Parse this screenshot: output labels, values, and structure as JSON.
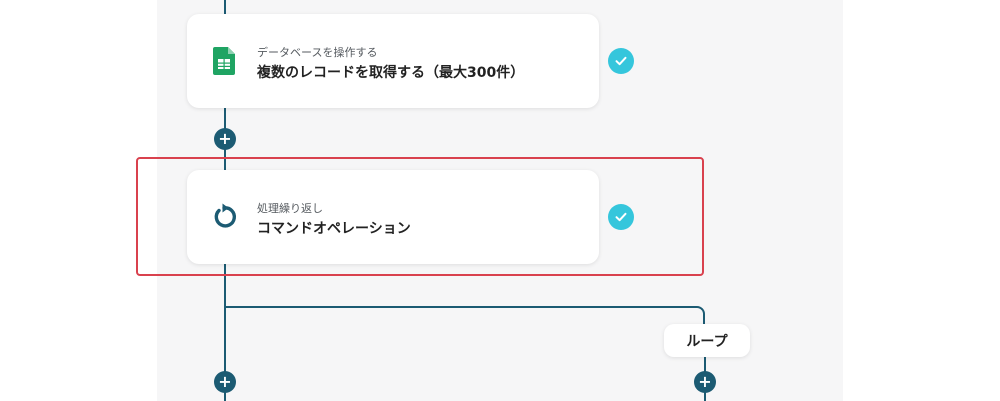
{
  "flow": {
    "steps": [
      {
        "subtitle": "データベースを操作する",
        "title": "複数のレコードを取得する（最大300件）",
        "icon": "google-sheets-icon",
        "status": "completed"
      },
      {
        "subtitle": "処理繰り返し",
        "title": "コマンドオペレーション",
        "icon": "loop-icon",
        "status": "completed"
      }
    ],
    "branch_label": "ループ",
    "add_symbol": "+"
  },
  "colors": {
    "connector": "#1c5b73",
    "check": "#35c6dc",
    "highlight": "#d9414e",
    "sheets_green": "#1fa463"
  }
}
